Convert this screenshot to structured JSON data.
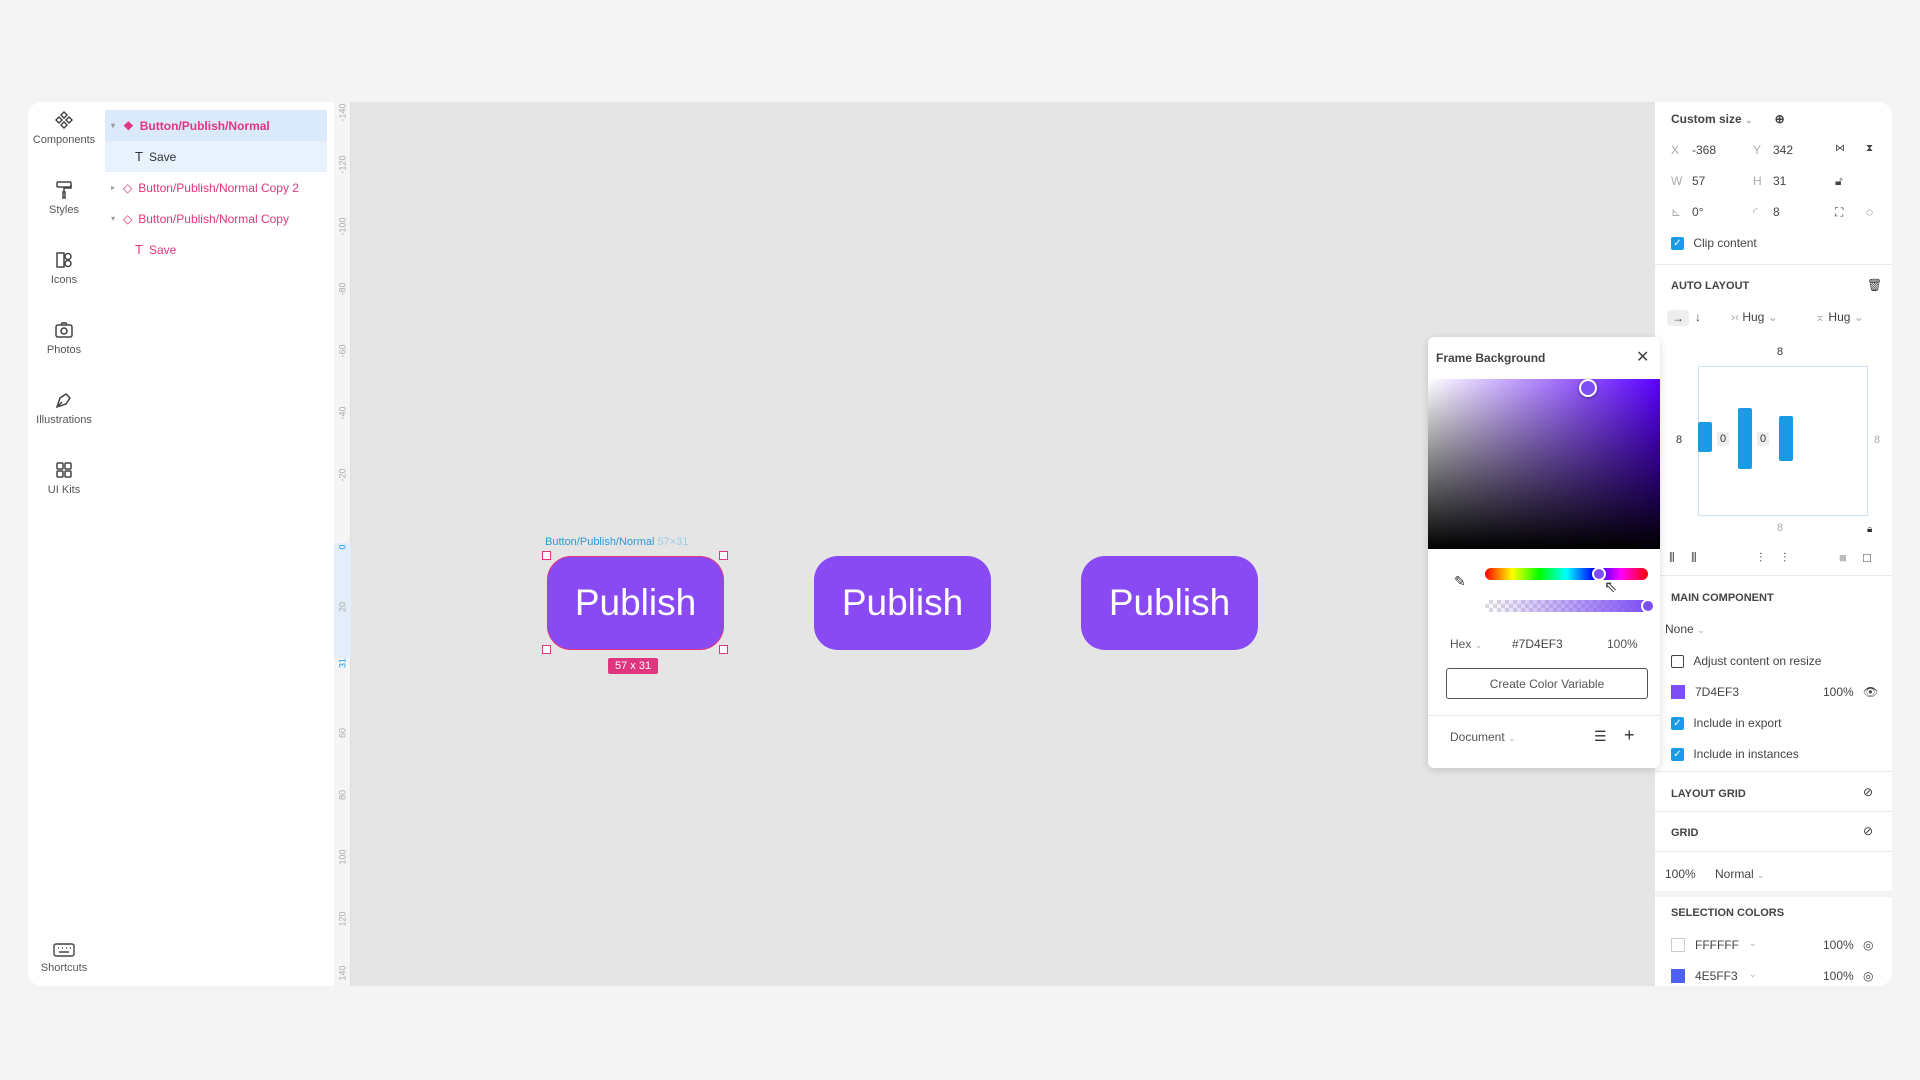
{
  "toolbar": {
    "items": [
      {
        "label": "Components",
        "icon": "components-icon"
      },
      {
        "label": "Styles",
        "icon": "paint-roller-icon"
      },
      {
        "label": "Icons",
        "icon": "icons-icon"
      },
      {
        "label": "Photos",
        "icon": "camera-icon"
      },
      {
        "label": "Illustrations",
        "icon": "pen-nib-icon"
      },
      {
        "label": "UI Kits",
        "icon": "grid-icon"
      }
    ],
    "shortcuts": "Shortcuts"
  },
  "layers": [
    {
      "name": "Button/Publish/Normal",
      "type": "component"
    },
    {
      "name": "Save",
      "type": "text"
    },
    {
      "name": "Button/Publish/Normal Copy 2",
      "type": "instance"
    },
    {
      "name": "Button/Publish/Normal Copy",
      "type": "instance"
    },
    {
      "name": "Save",
      "type": "text"
    }
  ],
  "ruler": [
    "-140",
    "-120",
    "-100",
    "-80",
    "-60",
    "-40",
    "-20",
    "0",
    "20",
    "31",
    "60",
    "80",
    "100",
    "120",
    "140"
  ],
  "canvas": {
    "selection_label": "Button/Publish/Normal",
    "selection_dims": "57×31",
    "size_badge": "57 x 31",
    "buttons": [
      "Publish",
      "Publish",
      "Publish"
    ]
  },
  "picker": {
    "title": "Frame Background",
    "mode": "Hex",
    "hex": "#7D4EF3",
    "opacity": "100%",
    "create_label": "Create Color Variable",
    "library": "Document",
    "hue_fraction": 0.7,
    "alpha_fraction": 1.0
  },
  "props": {
    "size_preset": "Custom size",
    "x_label": "X",
    "x": "-368",
    "y_label": "Y",
    "y": "342",
    "w_label": "W",
    "w": "57",
    "h_label": "H",
    "h": "31",
    "rotation": "0°",
    "radius": "8",
    "clip": "Clip content",
    "auto_layout": "AUTO LAYOUT",
    "hug_w": "Hug",
    "hug_h": "Hug",
    "pad_top": "8",
    "pad_left": "8",
    "pad_right": "8",
    "pad_bottom": "8",
    "gap1": "0",
    "gap2": "0",
    "main_component": "MAIN COMPONENT",
    "mc_value": "None",
    "adjust": "Adjust content on resize",
    "fill_hex": "7D4EF3",
    "fill_opacity": "100%",
    "include_export": "Include in export",
    "include_instances": "Include in instances",
    "layout_grid": "LAYOUT GRID",
    "grid": "GRID",
    "layer_opacity": "100%",
    "blend": "Normal",
    "selection_colors": "SELECTION COLORS",
    "colors": [
      {
        "hex": "FFFFFF",
        "opacity": "100%",
        "swatch": "#FFFFFF"
      },
      {
        "hex": "4E5FF3",
        "opacity": "100%",
        "swatch": "#4E5FF3"
      }
    ]
  },
  "colors": {
    "accent": "#8A4AF3",
    "selection": "#E0357F",
    "blue": "#1A9BE6"
  }
}
